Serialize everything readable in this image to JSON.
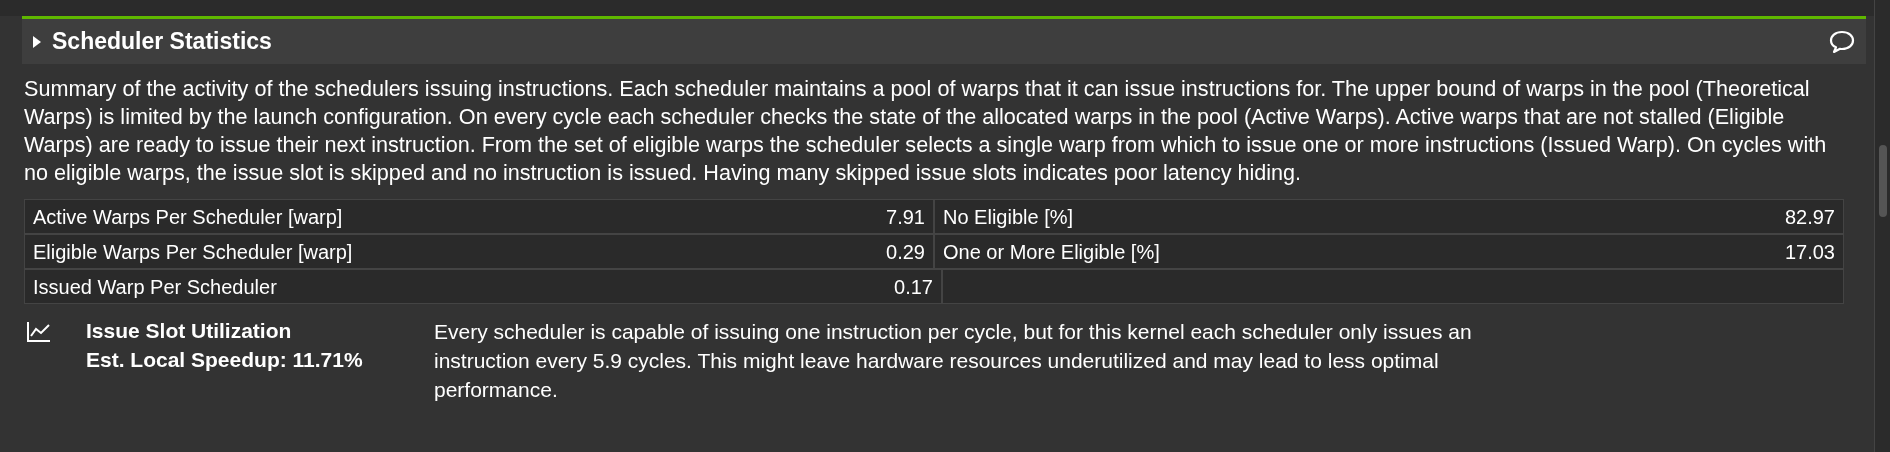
{
  "section": {
    "title": "Scheduler Statistics",
    "expanded": false,
    "description": "Summary of the activity of the schedulers issuing instructions. Each scheduler maintains a pool of warps that it can issue instructions for. The upper bound of warps in the pool (Theoretical Warps) is limited by the launch configuration. On every cycle each scheduler checks the state of the allocated warps in the pool (Active Warps). Active warps that are not stalled (Eligible Warps) are ready to issue their next instruction. From the set of eligible warps the scheduler selects a single warp from which to issue one or more instructions (Issued Warp). On cycles with no eligible warps, the issue slot is skipped and no instruction is issued. Having many skipped issue slots indicates poor latency hiding.",
    "metrics": [
      {
        "left": {
          "label": "Active Warps Per Scheduler [warp]",
          "value": "7.91"
        },
        "right": {
          "label": "No Eligible [%]",
          "value": "82.97"
        }
      },
      {
        "left": {
          "label": "Eligible Warps Per Scheduler [warp]",
          "value": "0.29"
        },
        "right": {
          "label": "One or More Eligible [%]",
          "value": "17.03"
        }
      },
      {
        "left": {
          "label": "Issued Warp Per Scheduler",
          "value": "0.17"
        }
      }
    ],
    "finding": {
      "title": "Issue Slot Utilization",
      "speedup": "Est. Local Speedup: 11.71%",
      "text": "Every scheduler is capable of issuing one instruction per cycle, but for this kernel each scheduler only issues an instruction every 5.9 cycles. This might leave hardware resources underutilized and may lead to less optimal performance."
    }
  }
}
